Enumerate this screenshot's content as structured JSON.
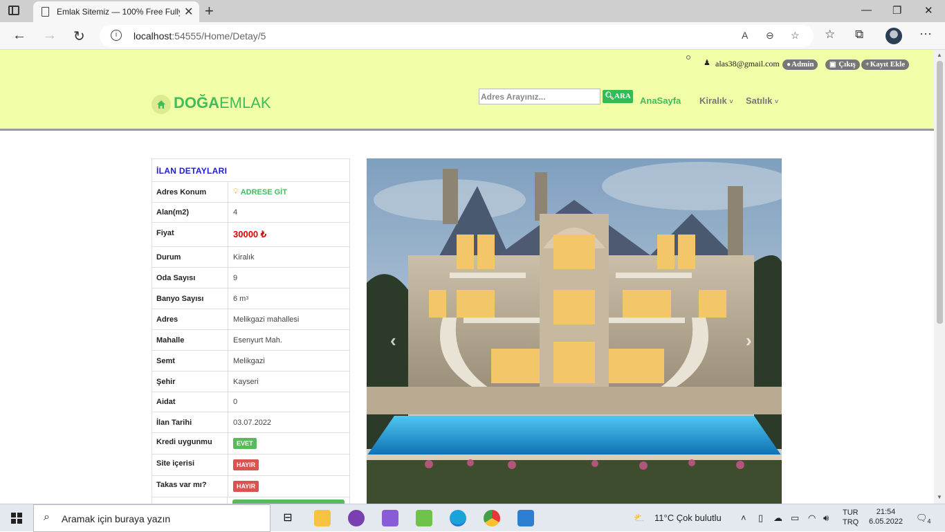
{
  "browser": {
    "tab_title": "Emlak Sitemiz — 100% Free Fully",
    "url_host": "localhost",
    "url_rest": ":54555/Home/Detay/5"
  },
  "header": {
    "email": "alas38@gmail.com",
    "admin_label": "Admin",
    "logout_label": "Çıkış",
    "add_label": "Kayıt Ekle",
    "logo_bold": "DOĞA",
    "logo_light": "EMLAK",
    "search_placeholder": "Adres Arayınız...",
    "search_button": "ARA",
    "nav_home": "AnaSayfa",
    "nav_rent": "Kiralık",
    "nav_sale": "Satılık"
  },
  "detail": {
    "title": "İLAN DETAYLARI",
    "rows": [
      {
        "label": "Adres Konum",
        "value": "ADRESE GİT"
      },
      {
        "label": "Alan(m2)",
        "value": "4"
      },
      {
        "label": "Fiyat",
        "value": "30000 ₺"
      },
      {
        "label": "Durum",
        "value": "Kiralık"
      },
      {
        "label": "Oda Sayısı",
        "value": "9"
      },
      {
        "label": "Banyo Sayısı",
        "value": "6 m",
        "sup": "3"
      },
      {
        "label": "Adres",
        "value": "Melikgazi mahallesi"
      },
      {
        "label": "Mahalle",
        "value": "Esenyurt Mah."
      },
      {
        "label": "Semt",
        "value": "Melikgazi"
      },
      {
        "label": "Şehir",
        "value": "Kayseri"
      },
      {
        "label": "Aidat",
        "value": "0"
      },
      {
        "label": "İlan Tarihi",
        "value": "03.07.2022"
      },
      {
        "label": "Kredi uygunmu",
        "value": "EVET"
      },
      {
        "label": "Site içerisi",
        "value": "HAYIR"
      },
      {
        "label": "Takas var mı?",
        "value": "HAYIR"
      }
    ]
  },
  "taskbar": {
    "search_text": "Aramak için buraya yazın",
    "weather": "11°C  Çok bulutlu",
    "lang1": "TUR",
    "lang2": "TRQ",
    "time": "21:54",
    "date": "6.05.2022",
    "notif_count": "4"
  },
  "colors": {
    "header_bg": "#f2fda8",
    "brand_green": "#3fbd5a",
    "price_red": "#e00000",
    "title_blue": "#1d1dd8"
  }
}
